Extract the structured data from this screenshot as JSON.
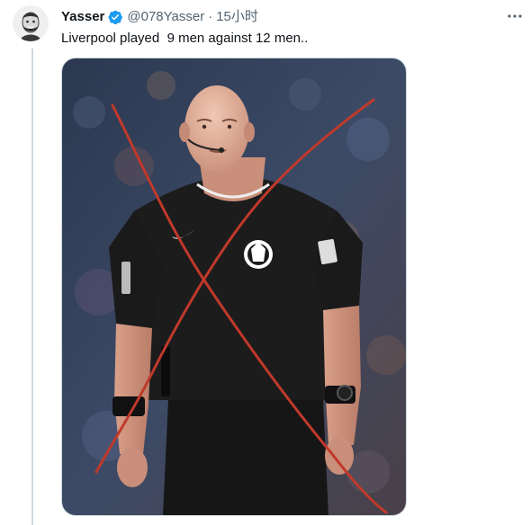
{
  "tweet": {
    "display_name": "Yasser",
    "handle": "@078Yasser",
    "separator": "·",
    "time": "15小时",
    "text": "Liverpool played  9 men against 12 men..",
    "verified": true
  },
  "icons": {
    "verified": "verified-badge-icon",
    "more": "more-horizontal-icon"
  },
  "colors": {
    "verified_blue": "#1d9bf0",
    "muted": "#536471",
    "cross_red": "#c0392b",
    "jersey": "#1a1a1a"
  }
}
